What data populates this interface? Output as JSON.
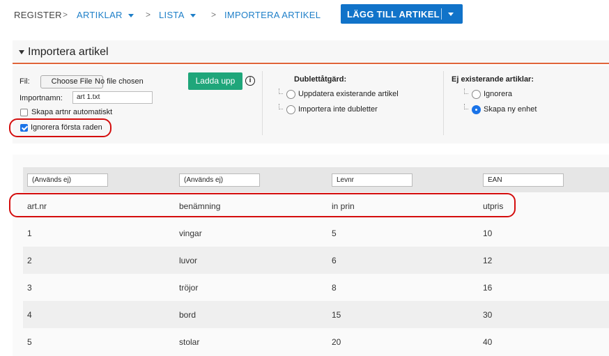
{
  "breadcrumb": {
    "register": "REGISTER",
    "artiklar": "ARTIKLAR",
    "lista": "LISTA",
    "current": "IMPORTERA ARTIKEL",
    "separator": ">"
  },
  "toolbar": {
    "add_article_label": "LÄGG TILL ARTIKEL"
  },
  "section": {
    "title": "Importera artikel"
  },
  "form": {
    "file_label": "Fil:",
    "choose_file_label": "Choose File",
    "no_file_text": "No file chosen",
    "import_name_label": "Importnamn:",
    "import_name_value": "art 1.txt",
    "auto_artnr_label": "Skapa artnr automatiskt",
    "auto_artnr_checked": false,
    "ignore_first_row_label": "Ignorera första raden",
    "ignore_first_row_checked": true,
    "upload_label": "Ladda upp",
    "info_icon": "i"
  },
  "duplicates": {
    "heading": "Dublettåtgärd:",
    "options": [
      "Uppdatera existerande artikel",
      "Importera inte dubletter"
    ],
    "selected": null
  },
  "nonexisting": {
    "heading": "Ej existerande artiklar:",
    "options": [
      "Ignorera",
      "Skapa ny enhet"
    ],
    "selected": "Skapa ny enhet"
  },
  "table": {
    "column_mappings": [
      "(Används ej)",
      "(Används ej)",
      "Levnr",
      "EAN"
    ],
    "rows": [
      [
        "art.nr",
        "benämning",
        "in prin",
        "utpris"
      ],
      [
        "1",
        "vingar",
        "5",
        "10"
      ],
      [
        "2",
        "luvor",
        "6",
        "12"
      ],
      [
        "3",
        "tröjor",
        "8",
        "16"
      ],
      [
        "4",
        "bord",
        "15",
        "30"
      ],
      [
        "5",
        "stolar",
        "20",
        "40"
      ]
    ]
  },
  "colors": {
    "accent_blue": "#1173c9",
    "upload_green": "#1fa67a",
    "section_underline": "#e0643a",
    "highlight_red": "#d40d0d"
  }
}
